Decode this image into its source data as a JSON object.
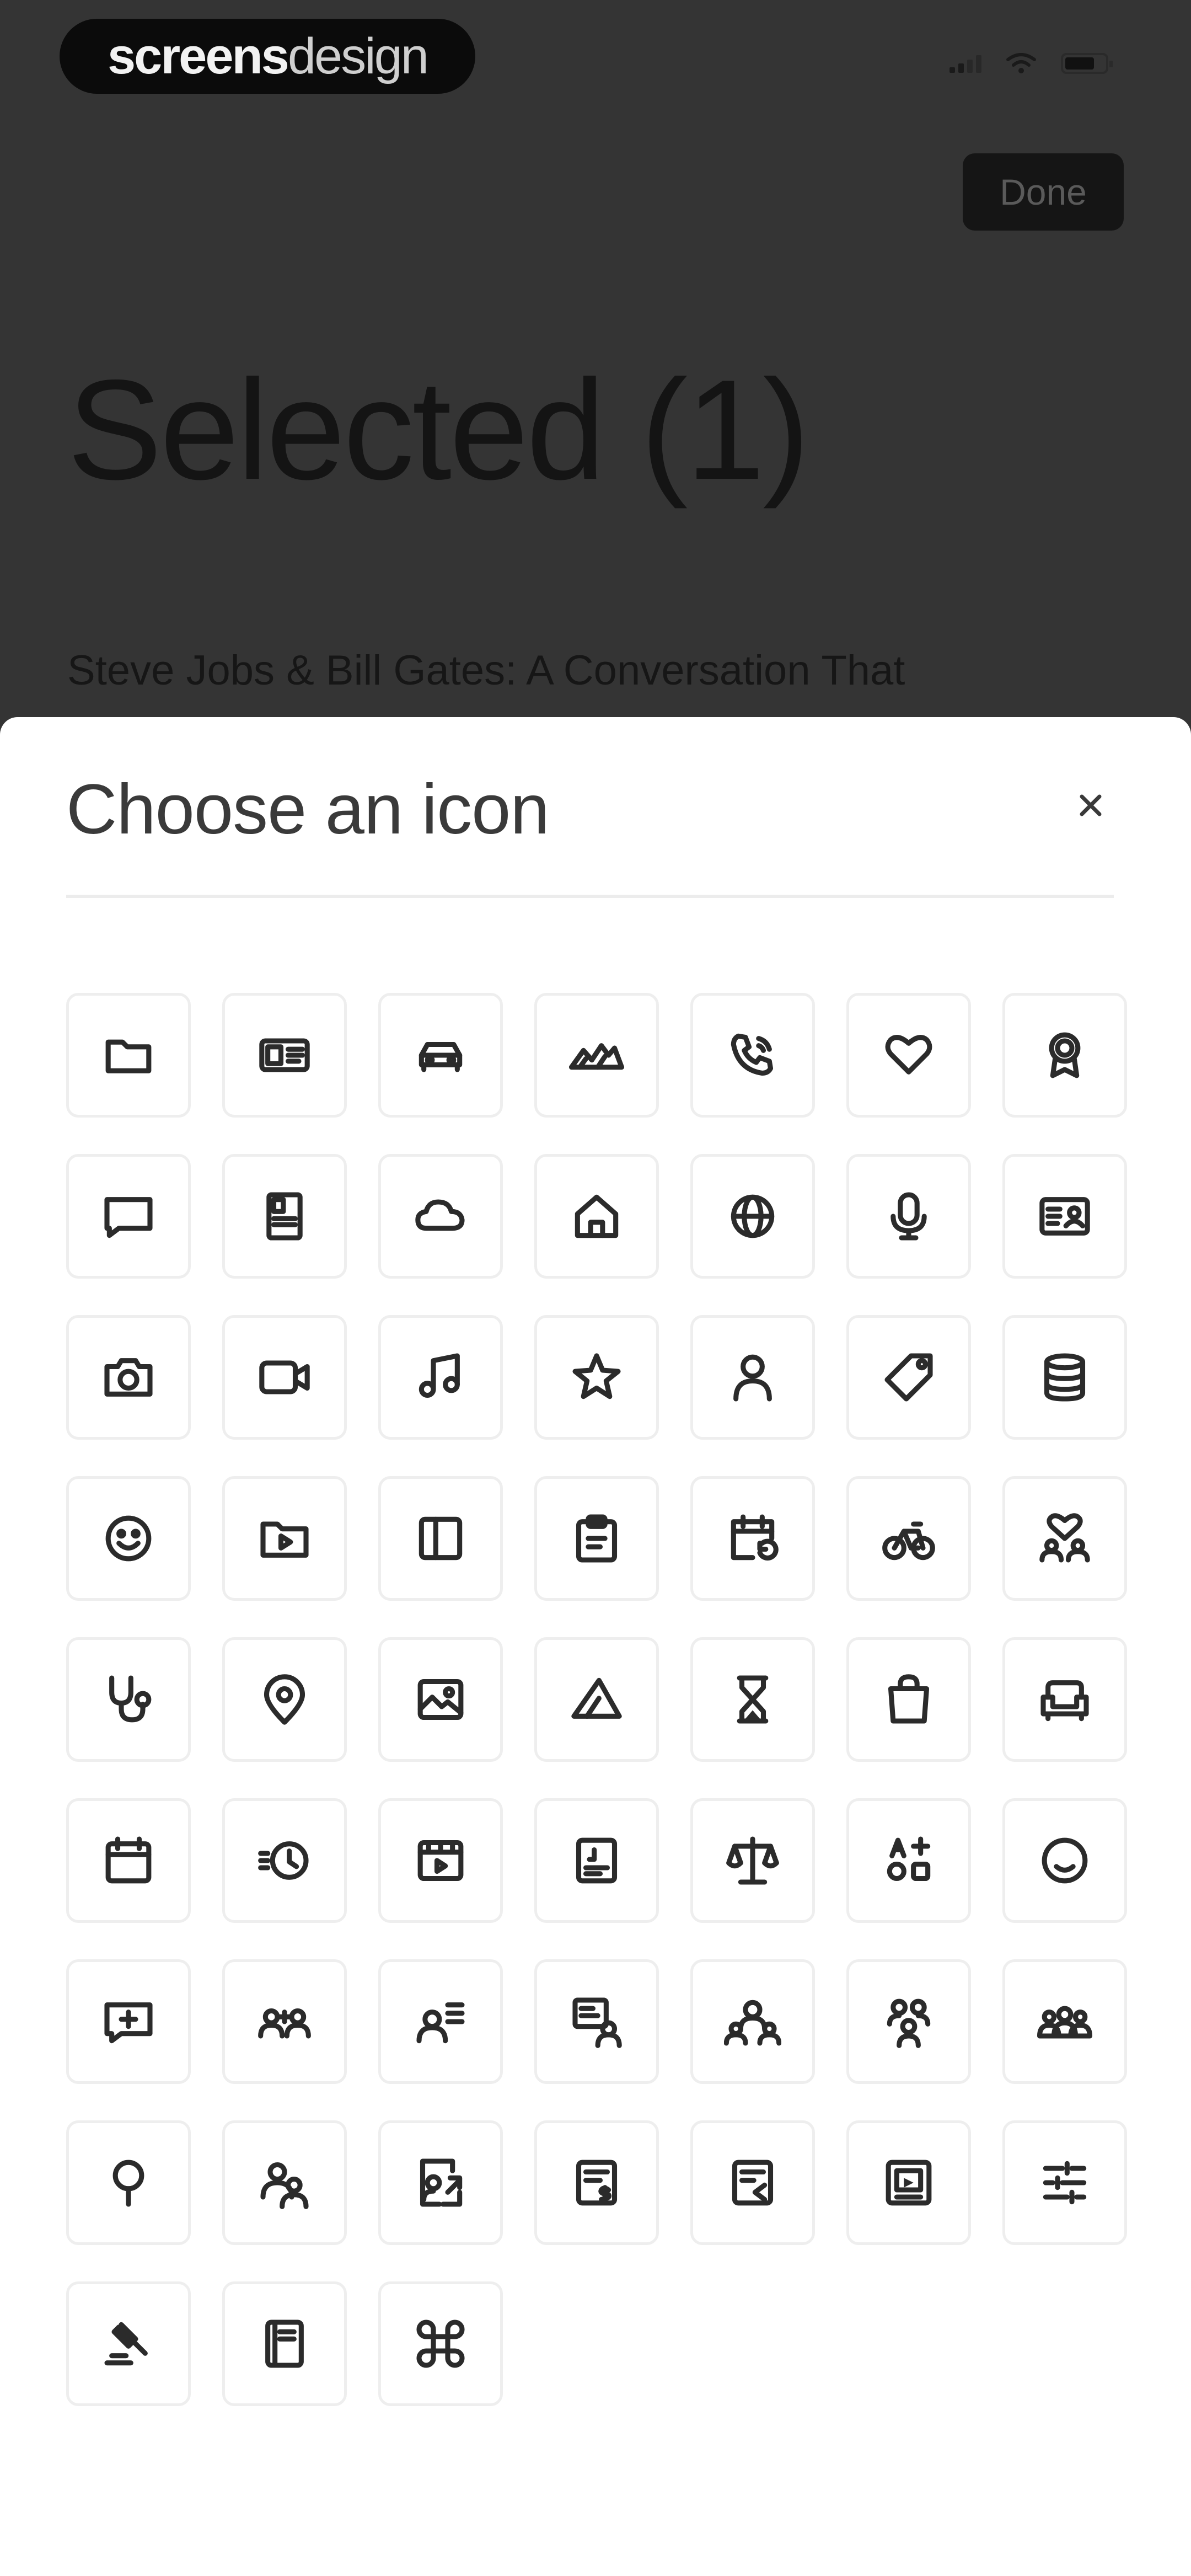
{
  "brand": {
    "part1": "screens",
    "part2": "design"
  },
  "header": {
    "done_label": "Done",
    "title": "Selected (1)"
  },
  "article": {
    "title": "Steve Jobs & Bill Gates: A Conversation That"
  },
  "sheet": {
    "title": "Choose an icon",
    "close_label": "×"
  },
  "icons": [
    "folder-icon",
    "id-card-icon",
    "car-icon",
    "mountain-icon",
    "phone-icon",
    "heart-icon",
    "award-icon",
    "chat-bubble-icon",
    "book-icon",
    "cloud-icon",
    "home-icon",
    "globe-icon",
    "microphone-icon",
    "contact-card-icon",
    "camera-icon",
    "video-icon",
    "music-note-icon",
    "star-icon",
    "user-icon",
    "tag-icon",
    "database-icon",
    "smiley-icon",
    "folder-play-icon",
    "sidebar-panel-icon",
    "clipboard-icon",
    "calendar-repeat-icon",
    "bicycle-icon",
    "people-heart-icon",
    "stethoscope-icon",
    "location-pin-icon",
    "image-icon",
    "shapes-icon",
    "hourglass-icon",
    "bag-icon",
    "sofa-icon",
    "calendar-icon",
    "history-icon",
    "movie-ticket-icon",
    "document-icon",
    "scale-icon",
    "grid-apps-icon",
    "emoji-icon",
    "message-square-icon",
    "users-couple-icon",
    "user-list-icon",
    "user-badge-icon",
    "team-icon",
    "group-icon",
    "audience-icon",
    "pin-icon",
    "users-icon",
    "document-share-icon",
    "invoice-icon",
    "news-icon",
    "image-frame-icon",
    "sliders-icon",
    "gavel-icon",
    "notebook-icon",
    "command-icon"
  ]
}
